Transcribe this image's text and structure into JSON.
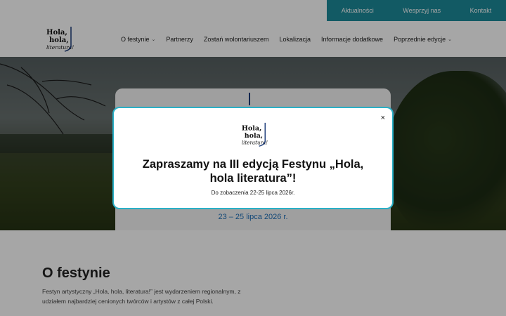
{
  "topbar": {
    "links": [
      "Aktualności",
      "Wesprzyj nas",
      "Kontakt"
    ],
    "color": "#1c8a9a"
  },
  "logo": {
    "line1": "Hola,",
    "line2": "hola,",
    "line3": "literatura!"
  },
  "nav": {
    "items": [
      {
        "label": "O festynie",
        "dropdown": true
      },
      {
        "label": "Partnerzy",
        "dropdown": false
      },
      {
        "label": "Zostań wolontariuszem",
        "dropdown": false
      },
      {
        "label": "Lokalizacja",
        "dropdown": false
      },
      {
        "label": "Informacje dodatkowe",
        "dropdown": false
      },
      {
        "label": "Poprzednie edycje",
        "dropdown": true
      }
    ]
  },
  "hero": {
    "date": "23 – 25 lipca 2026 r."
  },
  "about": {
    "title": "O festynie",
    "text": "Festyn artystyczny „Hola, hola, literatura!” jest wydarzeniem regionalnym, z udziałem najbardziej cenionych twórców i artystów z całej Polski."
  },
  "modal": {
    "close_label": "×",
    "title": "Zapraszamy na III edycją Festynu „Hola, hola literatura”!",
    "subtitle": "Do zobaczenia 22-25 lipca 2026r.",
    "border_color": "#2ab0c6"
  }
}
